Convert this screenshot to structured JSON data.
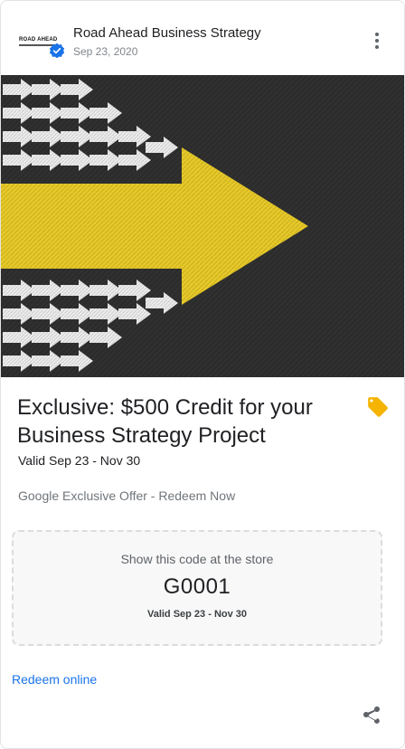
{
  "header": {
    "business_name": "Road Ahead Business Strategy",
    "date": "Sep 23, 2020",
    "logo_text": "ROAD AHEAD",
    "logo_icon": "road-ahead-logo",
    "verified_icon": "verified-badge-icon",
    "menu_icon": "more-vert-icon"
  },
  "hero": {
    "image_icon": "arrows-chalkboard-image",
    "colors": {
      "background": "#2b2b2b",
      "arrow_big": "#e6c929",
      "arrow_small": "#e9e9e9"
    }
  },
  "offer": {
    "title": "Exclusive: $500 Credit for your Business Strategy Project",
    "valid": "Valid Sep 23 - Nov 30",
    "description": "Google Exclusive Offer - Redeem Now",
    "tag_icon": "offer-tag-icon",
    "tag_color": "#f4b400"
  },
  "code": {
    "label": "Show this code at the store",
    "value": "G0001",
    "valid": "Valid Sep 23 - Nov 30"
  },
  "actions": {
    "redeem_label": "Redeem online",
    "redeem_color": "#1a73e8",
    "share_icon": "share-icon"
  }
}
